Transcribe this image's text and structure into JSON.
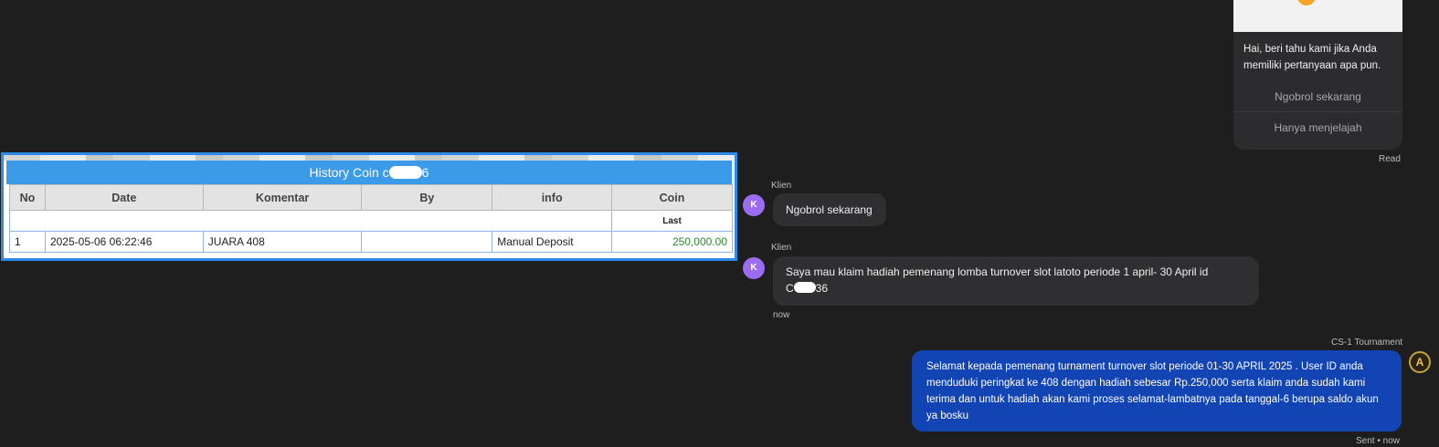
{
  "history": {
    "title_prefix": "History Coin c",
    "title_suffix": "6",
    "columns": [
      "No",
      "Date",
      "Komentar",
      "By",
      "info",
      "Coin"
    ],
    "subheader_last": "Last",
    "rows": [
      {
        "no": "1",
        "date": "2025-05-06 06:22:46",
        "komentar": "JUARA 408",
        "by": "",
        "info": "Manual Deposit",
        "coin": "250,000.00"
      }
    ]
  },
  "chat": {
    "welcome": {
      "text": "Hai, beri tahu kami jika Anda memiliki pertanyaan apa pun.",
      "chat_now": "Ngobrol sekarang",
      "just_browse": "Hanya menjelajah",
      "read": "Read"
    },
    "messages": [
      {
        "sender": "Klien",
        "avatar": "K",
        "text": "Ngobrol sekarang"
      },
      {
        "sender": "Klien",
        "avatar": "K",
        "line1": "Saya mau klaim hadiah pemenang lomba turnover slot latoto periode 1 april- 30 April id",
        "line2_prefix": "C",
        "line2_suffix": "36",
        "time": "now"
      }
    ],
    "reply": {
      "sender": "CS-1 Tournament",
      "avatar": "A",
      "text": "Selamat kepada pemenang turnament turnover slot periode 01-30 APRIL 2025 . User ID anda menduduki peringkat ke 408 dengan hadiah sebesar Rp.250,000 serta klaim anda sudah kami terima dan untuk hadiah akan kami proses selamat-lambatnya pada tanggal-6 berupa saldo akun ya bosku",
      "status": "Sent • now"
    }
  }
}
